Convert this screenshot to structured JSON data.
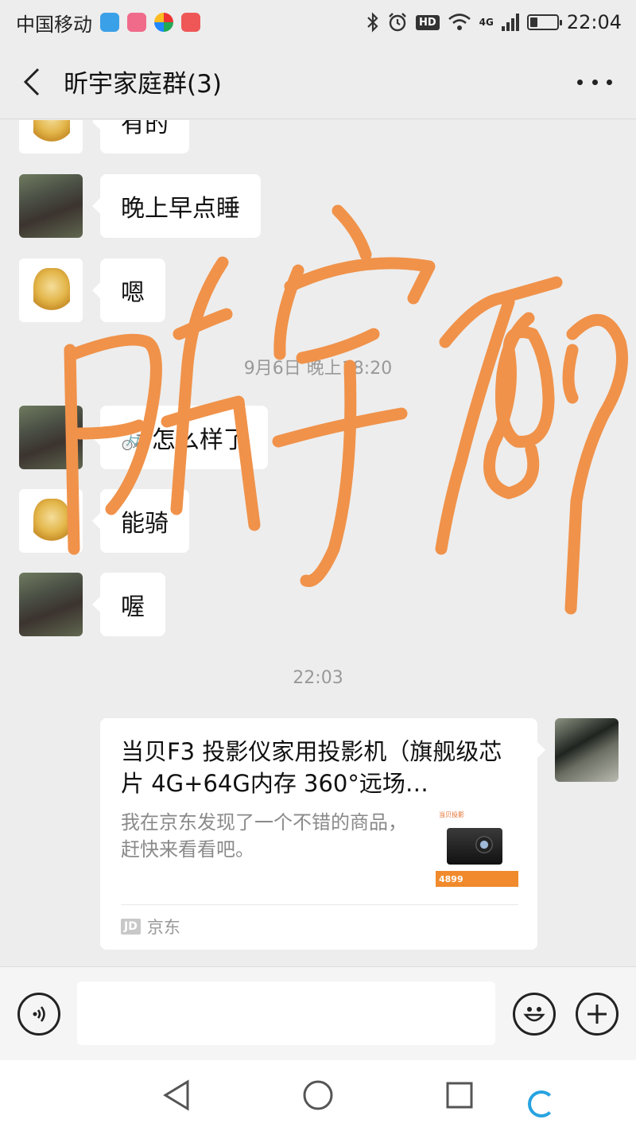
{
  "status_bar": {
    "carrier": "中国移动",
    "network_type": "4G",
    "time": "22:04",
    "battery_level": 0.3,
    "icons": [
      "shield-app-icon",
      "baby-app-icon",
      "camera-app-icon",
      "gift-app-icon",
      "bluetooth-icon",
      "alarm-icon",
      "hd-icon",
      "wifi-icon",
      "signal-icon",
      "battery-icon"
    ],
    "hd_label": "HD"
  },
  "header": {
    "title": "昕宇家庭群(3)"
  },
  "messages": [
    {
      "sender": "gold-avatar",
      "text": "有的"
    },
    {
      "sender": "rock-avatar",
      "text": "晚上早点睡"
    },
    {
      "sender": "gold-avatar",
      "text": "嗯"
    },
    {
      "sender": "rock-avatar",
      "text": "怎么样了",
      "emoji": "🚲"
    },
    {
      "sender": "gold-avatar",
      "text": "能骑"
    },
    {
      "sender": "rock-avatar",
      "text": "喔"
    }
  ],
  "timestamps": {
    "first": "9月6日 晚上18:20",
    "second": "22:03"
  },
  "shared_card": {
    "title": "当贝F3 投影仪家用投影机（旗舰级芯片 4G+64G内存 360°远场…",
    "description": "我在京东发现了一个不错的商品，赶快来看看吧。",
    "thumb_brand": "当贝投影",
    "thumb_price": "4899",
    "source_logo": "JD",
    "source_name": "京东"
  },
  "input": {
    "value": "",
    "placeholder": ""
  },
  "overlay": {
    "handwriting": "昕宇789",
    "color": "#f0924a"
  },
  "colors": {
    "background": "#ededed",
    "bubble": "#ffffff",
    "timestamp": "#999999",
    "accent": "#27a3e0"
  }
}
